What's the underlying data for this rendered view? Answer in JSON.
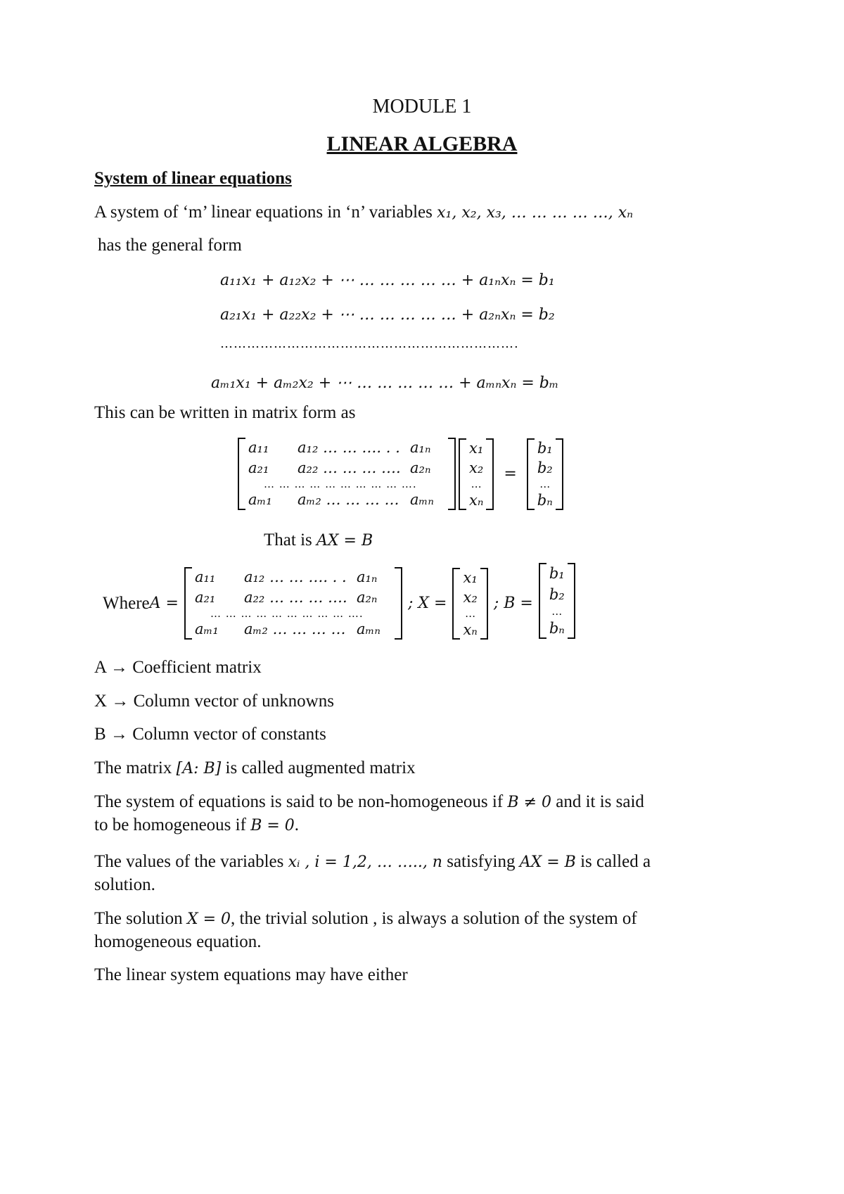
{
  "module_label": "MODULE 1",
  "title": "LINEAR ALGEBRA",
  "section_heading": "System of linear equations",
  "intro": {
    "line1_text": "A system of ‘m’ linear equations in ‘n’ variables ",
    "line1_vars": "x₁, x₂, x₃, … … … … …, xₙ",
    "line2_text": "has the general form"
  },
  "general_form": {
    "eq1": "a₁₁x₁ + a₁₂x₂ + ⋯ … … … … … + a₁ₙxₙ = b₁",
    "eq2": "a₂₁x₁ + a₂₂x₂ + ⋯ … … … … … + a₂ₙxₙ = b₂",
    "ellipsis_row": "………………………………………………………….",
    "eqm": "aₘ₁x₁ + aₘ₂x₂ + ⋯ … … … … … + aₘₙxₙ = bₘ"
  },
  "matrix_form_intro": "This can be written in matrix form as",
  "matrix_A": {
    "rows": [
      [
        "a₁₁",
        "a₁₂ … … …. . .",
        "a₁ₙ"
      ],
      [
        "a₂₁",
        "a₂₂ … … … ….",
        "a₂ₙ"
      ],
      [
        "aₘ₁",
        "aₘ₂ … … … …",
        "aₘₙ"
      ]
    ],
    "dots_row": "… … … … … … … … … ….",
    "dots_row_where": "… … … … … … … … … ….",
    "row1_where": "a₁₂ … … …. . .",
    "row2_where": "a₂₂ … … … ….",
    "row3_where": "aₘ₂ … … … …"
  },
  "vector_X": [
    "x₁",
    "x₂",
    "…",
    "xₙ"
  ],
  "vector_B": [
    "b₁",
    "b₂",
    "…",
    "bₙ"
  ],
  "equals_sign": "=",
  "that_is": {
    "text": "That is ",
    "equation": "AX = B"
  },
  "where": {
    "label": "Where ",
    "A_eq": "A =",
    "X_eq": "; X =",
    "B_eq": "; B ="
  },
  "definitions": [
    {
      "symbol": "A",
      "arrow": "→",
      "meaning": "Coefficient matrix"
    },
    {
      "symbol": "X",
      "arrow": "→",
      "meaning": "Column vector of unknowns"
    },
    {
      "symbol": "B",
      "arrow": "→",
      "meaning": "Column vector of constants"
    }
  ],
  "paragraphs": {
    "augmented": {
      "pre": "The matrix ",
      "math": "[A: B]",
      "post": " is called augmented matrix"
    },
    "homogeneous": {
      "pre": "The system of equations is said to be non-homogeneous if ",
      "math1": "B ≠ 0",
      "mid": " and it is said",
      "line2_pre": "to be homogeneous if ",
      "math2": "B = 0",
      "line2_post": "."
    },
    "solution": {
      "pre": "The values of the variables ",
      "math1": "xᵢ , i = 1,2, … ….., n",
      "mid": "  satisfying ",
      "math2": "AX = B",
      "post": " is called a",
      "line2": "solution."
    },
    "trivial": {
      "pre": "The solution ",
      "math": "X = 0",
      "post": ", the trivial solution , is always a solution of the system of",
      "line2": "homogeneous equation."
    },
    "either": "The linear system equations may have either"
  }
}
